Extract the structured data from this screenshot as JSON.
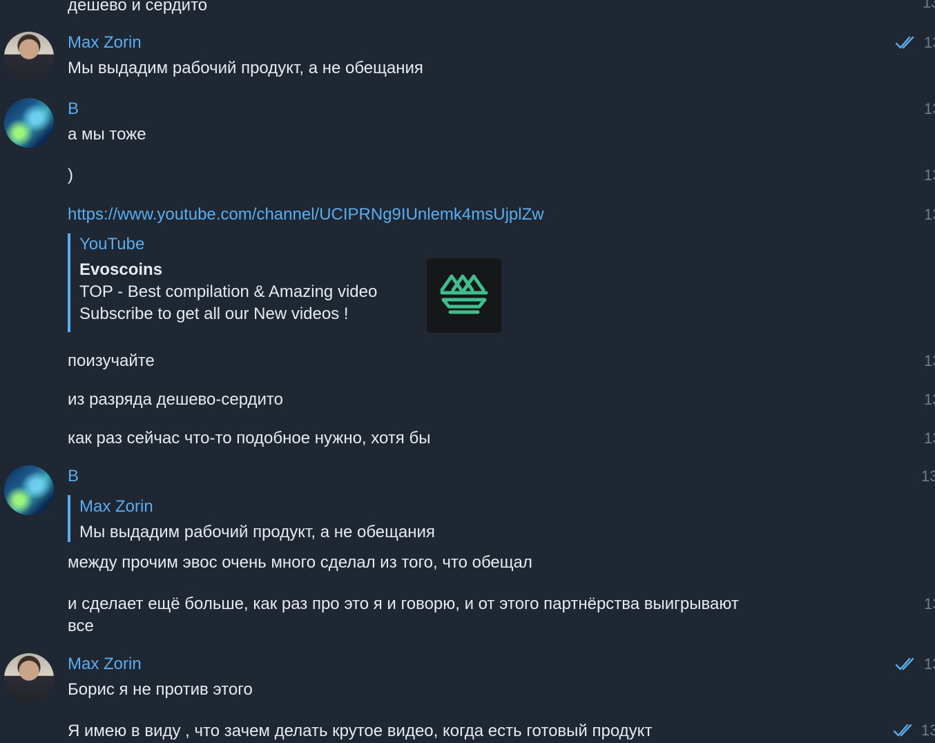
{
  "time_stub": "13",
  "messages": {
    "m0": {
      "text": "дешево и сердито"
    },
    "m1": {
      "sender": "Max Zorin",
      "text": "Мы выдадим рабочий продукт, а не обещания"
    },
    "m2": {
      "sender": "B",
      "text": "а мы тоже"
    },
    "m3": {
      "text": ")"
    },
    "m4": {
      "link": "https://www.youtube.com/channel/UCIPRNg9IUnlemk4msUjplZw",
      "preview": {
        "site": "YouTube",
        "title": "Evoscoins",
        "line1": "TOP - Best compilation & Amazing video",
        "line2": "Subscribe to get all our New videos !",
        "thumb_icon": "evoscoins-logo-icon"
      }
    },
    "m5": {
      "text": "поизучайте"
    },
    "m6": {
      "text": "из разряда дешево-сердито"
    },
    "m7": {
      "text": "как раз сейчас что-то подобное нужно, хотя бы"
    },
    "m8": {
      "sender": "B",
      "reply": {
        "sender": "Max Zorin",
        "text": "Мы выдадим рабочий продукт, а не обещания"
      },
      "text": "между прочим эвос очень много сделал из того, что обещал"
    },
    "m9": {
      "line1": "и сделает ещё больше, как раз про это я и говорю, и от этого партнёрства выигрывают",
      "line2": "все"
    },
    "m10": {
      "sender": "Max Zorin",
      "text": "Борис я не против этого"
    },
    "m11": {
      "text": "Я имею в виду , что зачем делать крутое видео, когда есть готовый продукт"
    }
  },
  "colors": {
    "background": "#1e2732",
    "accent": "#5aaef0",
    "text": "#e7ebef",
    "muted": "#6d7f8f"
  }
}
